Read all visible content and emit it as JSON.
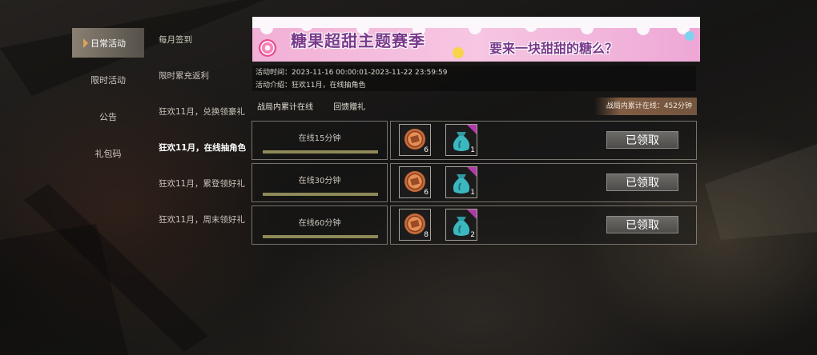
{
  "nav": {
    "items": [
      {
        "label": "日常活动",
        "active": true
      },
      {
        "label": "限时活动",
        "active": false
      },
      {
        "label": "公告",
        "active": false
      },
      {
        "label": "礼包码",
        "active": false
      }
    ]
  },
  "sub": {
    "items": [
      {
        "label": "每月签到",
        "active": false
      },
      {
        "label": "限时累充返利",
        "active": false
      },
      {
        "label": "狂欢11月，兑换领豪礼",
        "active": false
      },
      {
        "label": "狂欢11月，在线抽角色",
        "active": true
      },
      {
        "label": "狂欢11月，累登领好礼",
        "active": false
      },
      {
        "label": "狂欢11月，周末领好礼",
        "active": false
      }
    ]
  },
  "banner": {
    "title": "糖果超甜主题赛季",
    "subtitle": "要来一块甜甜的糖么？"
  },
  "info": {
    "time": "活动时间：2023-11-16 00:00:01-2023-11-22 23:59:59",
    "desc": "活动介绍：狂欢11月，在线抽角色"
  },
  "tabs": [
    "战局内累计在线",
    "回馈赠礼"
  ],
  "total_online": "战局内累计在线：452分钟",
  "rows": [
    {
      "label": "在线15分钟",
      "progress": 1.0,
      "rewards": [
        {
          "icon": "coin-icon",
          "count": "6"
        },
        {
          "icon": "bag-icon",
          "count": "1"
        }
      ],
      "claim": "已领取"
    },
    {
      "label": "在线30分钟",
      "progress": 1.0,
      "rewards": [
        {
          "icon": "coin-icon",
          "count": "6"
        },
        {
          "icon": "bag-icon",
          "count": "1"
        }
      ],
      "claim": "已领取"
    },
    {
      "label": "在线60分钟",
      "progress": 1.0,
      "rewards": [
        {
          "icon": "coin-icon",
          "count": "8"
        },
        {
          "icon": "bag-icon",
          "count": "2"
        }
      ],
      "claim": "已领取"
    }
  ]
}
